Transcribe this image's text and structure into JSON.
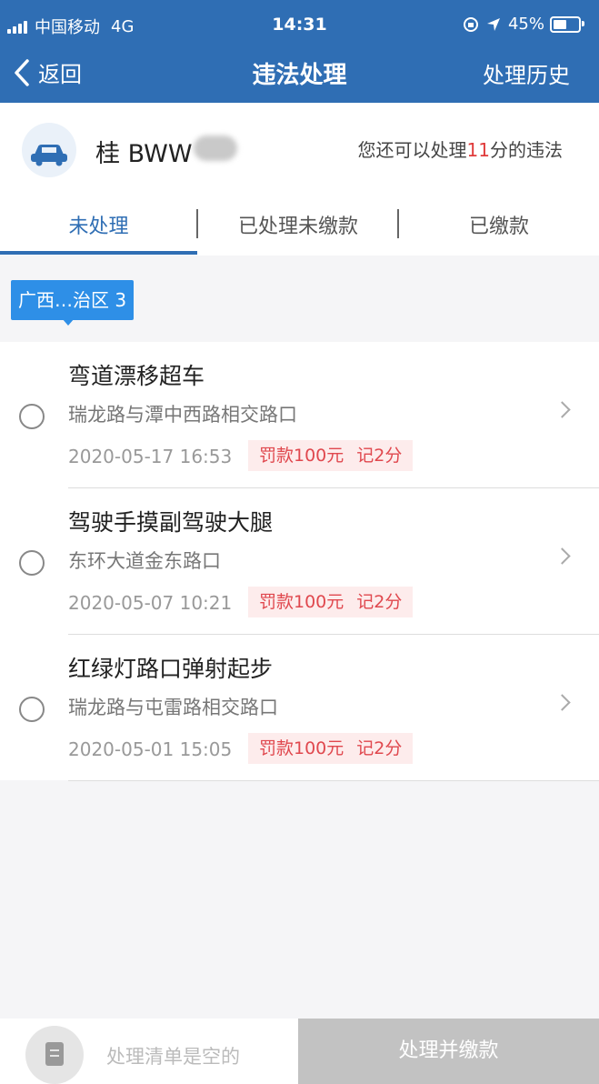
{
  "status_bar": {
    "carrier": "中国移动",
    "network": "4G",
    "time": "14:31",
    "battery": "45%",
    "battery_level": 0.45
  },
  "nav": {
    "back_label": "返回",
    "title": "违法处理",
    "history_label": "处理历史"
  },
  "vehicle": {
    "plate_visible": "桂 BWW",
    "points_prefix": "您还可以处理",
    "points_value": "11",
    "points_suffix": "分的违法"
  },
  "tabs": [
    {
      "label": "未处理",
      "active": true
    },
    {
      "label": "已处理未缴款",
      "active": false
    },
    {
      "label": "已缴款",
      "active": false
    }
  ],
  "region_tag": "广西…治区 3",
  "violations": [
    {
      "title": "弯道漂移超车",
      "location": "瑞龙路与潭中西路相交路口",
      "datetime": "2020-05-17 16:53",
      "fine": "罚款100元",
      "points": "记2分"
    },
    {
      "title": "驾驶手摸副驾驶大腿",
      "location": "东环大道金东路口",
      "datetime": "2020-05-07 10:21",
      "fine": "罚款100元",
      "points": "记2分"
    },
    {
      "title": "红绿灯路口弹射起步",
      "location": "瑞龙路与屯雷路相交路口",
      "datetime": "2020-05-01 15:05",
      "fine": "罚款100元",
      "points": "记2分"
    }
  ],
  "bottom_bar": {
    "empty_text": "处理清单是空的",
    "pay_button": "处理并缴款"
  },
  "colors": {
    "brand_blue": "#2f6eb4",
    "region_blue": "#2e8fe7",
    "fine_red": "#e0484e",
    "disabled_gray": "#c2c2c2"
  }
}
